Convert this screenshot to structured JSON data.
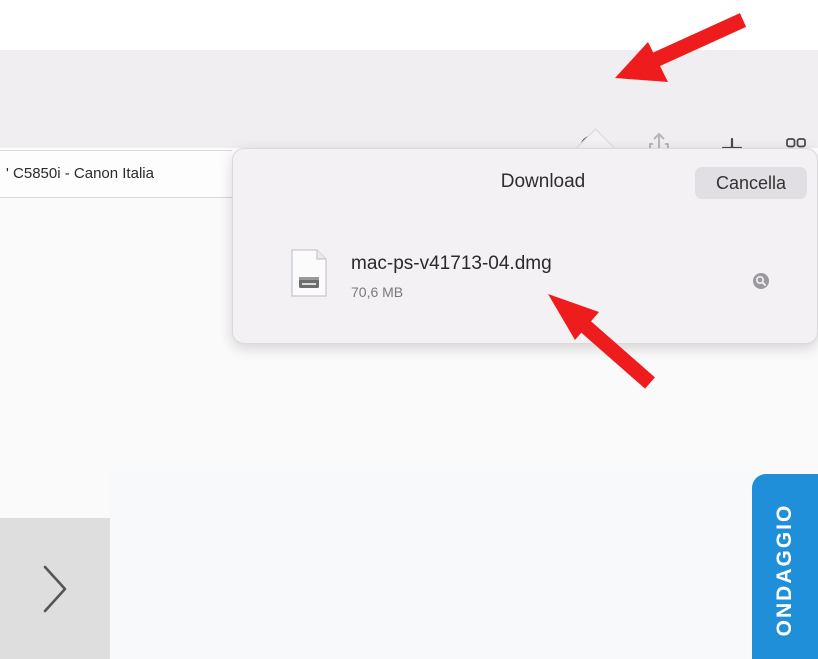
{
  "tab": {
    "title": "' C5850i - Canon Italia"
  },
  "downloads_popover": {
    "title": "Download",
    "clear_label": "Cancella",
    "items": [
      {
        "name": "mac-ps-v41713-04.dmg",
        "size": "70,6 MB"
      }
    ]
  },
  "survey_tab": {
    "label": "ONDAGGIO"
  },
  "icons": {
    "toolbar": [
      "download-icon",
      "share-icon",
      "new-tab-icon",
      "tab-overview-icon"
    ],
    "popover": [
      "dmg-file-icon",
      "magnifier-icon"
    ],
    "content": [
      "chevron-right-icon"
    ],
    "annotations": [
      "red-arrow-icon"
    ]
  },
  "colors": {
    "toolbar_bg": "#f1eef2",
    "popover_bg": "#f4f1f5",
    "survey_blue": "#1f8fd9",
    "annotation_red": "#ee1c1c"
  }
}
